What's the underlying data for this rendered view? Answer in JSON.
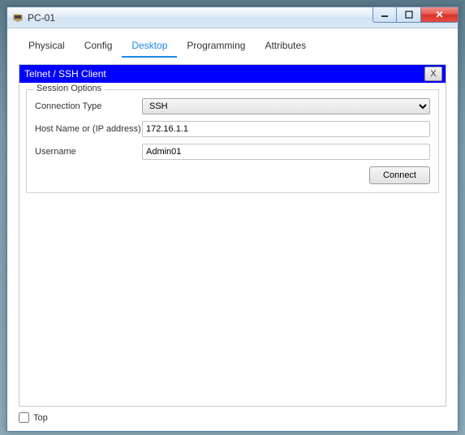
{
  "window": {
    "title": "PC-01"
  },
  "tabs": [
    {
      "label": "Physical"
    },
    {
      "label": "Config"
    },
    {
      "label": "Desktop"
    },
    {
      "label": "Programming"
    },
    {
      "label": "Attributes"
    }
  ],
  "active_tab_index": 2,
  "panel": {
    "title": "Telnet / SSH Client",
    "close_label": "X"
  },
  "session": {
    "legend": "Session Options",
    "connection_type_label": "Connection Type",
    "connection_type_value": "SSH",
    "host_label": "Host Name or (IP address)",
    "host_value": "172.16.1.1",
    "username_label": "Username",
    "username_value": "Admin01",
    "connect_label": "Connect"
  },
  "footer": {
    "top_label": "Top",
    "top_checked": false
  }
}
